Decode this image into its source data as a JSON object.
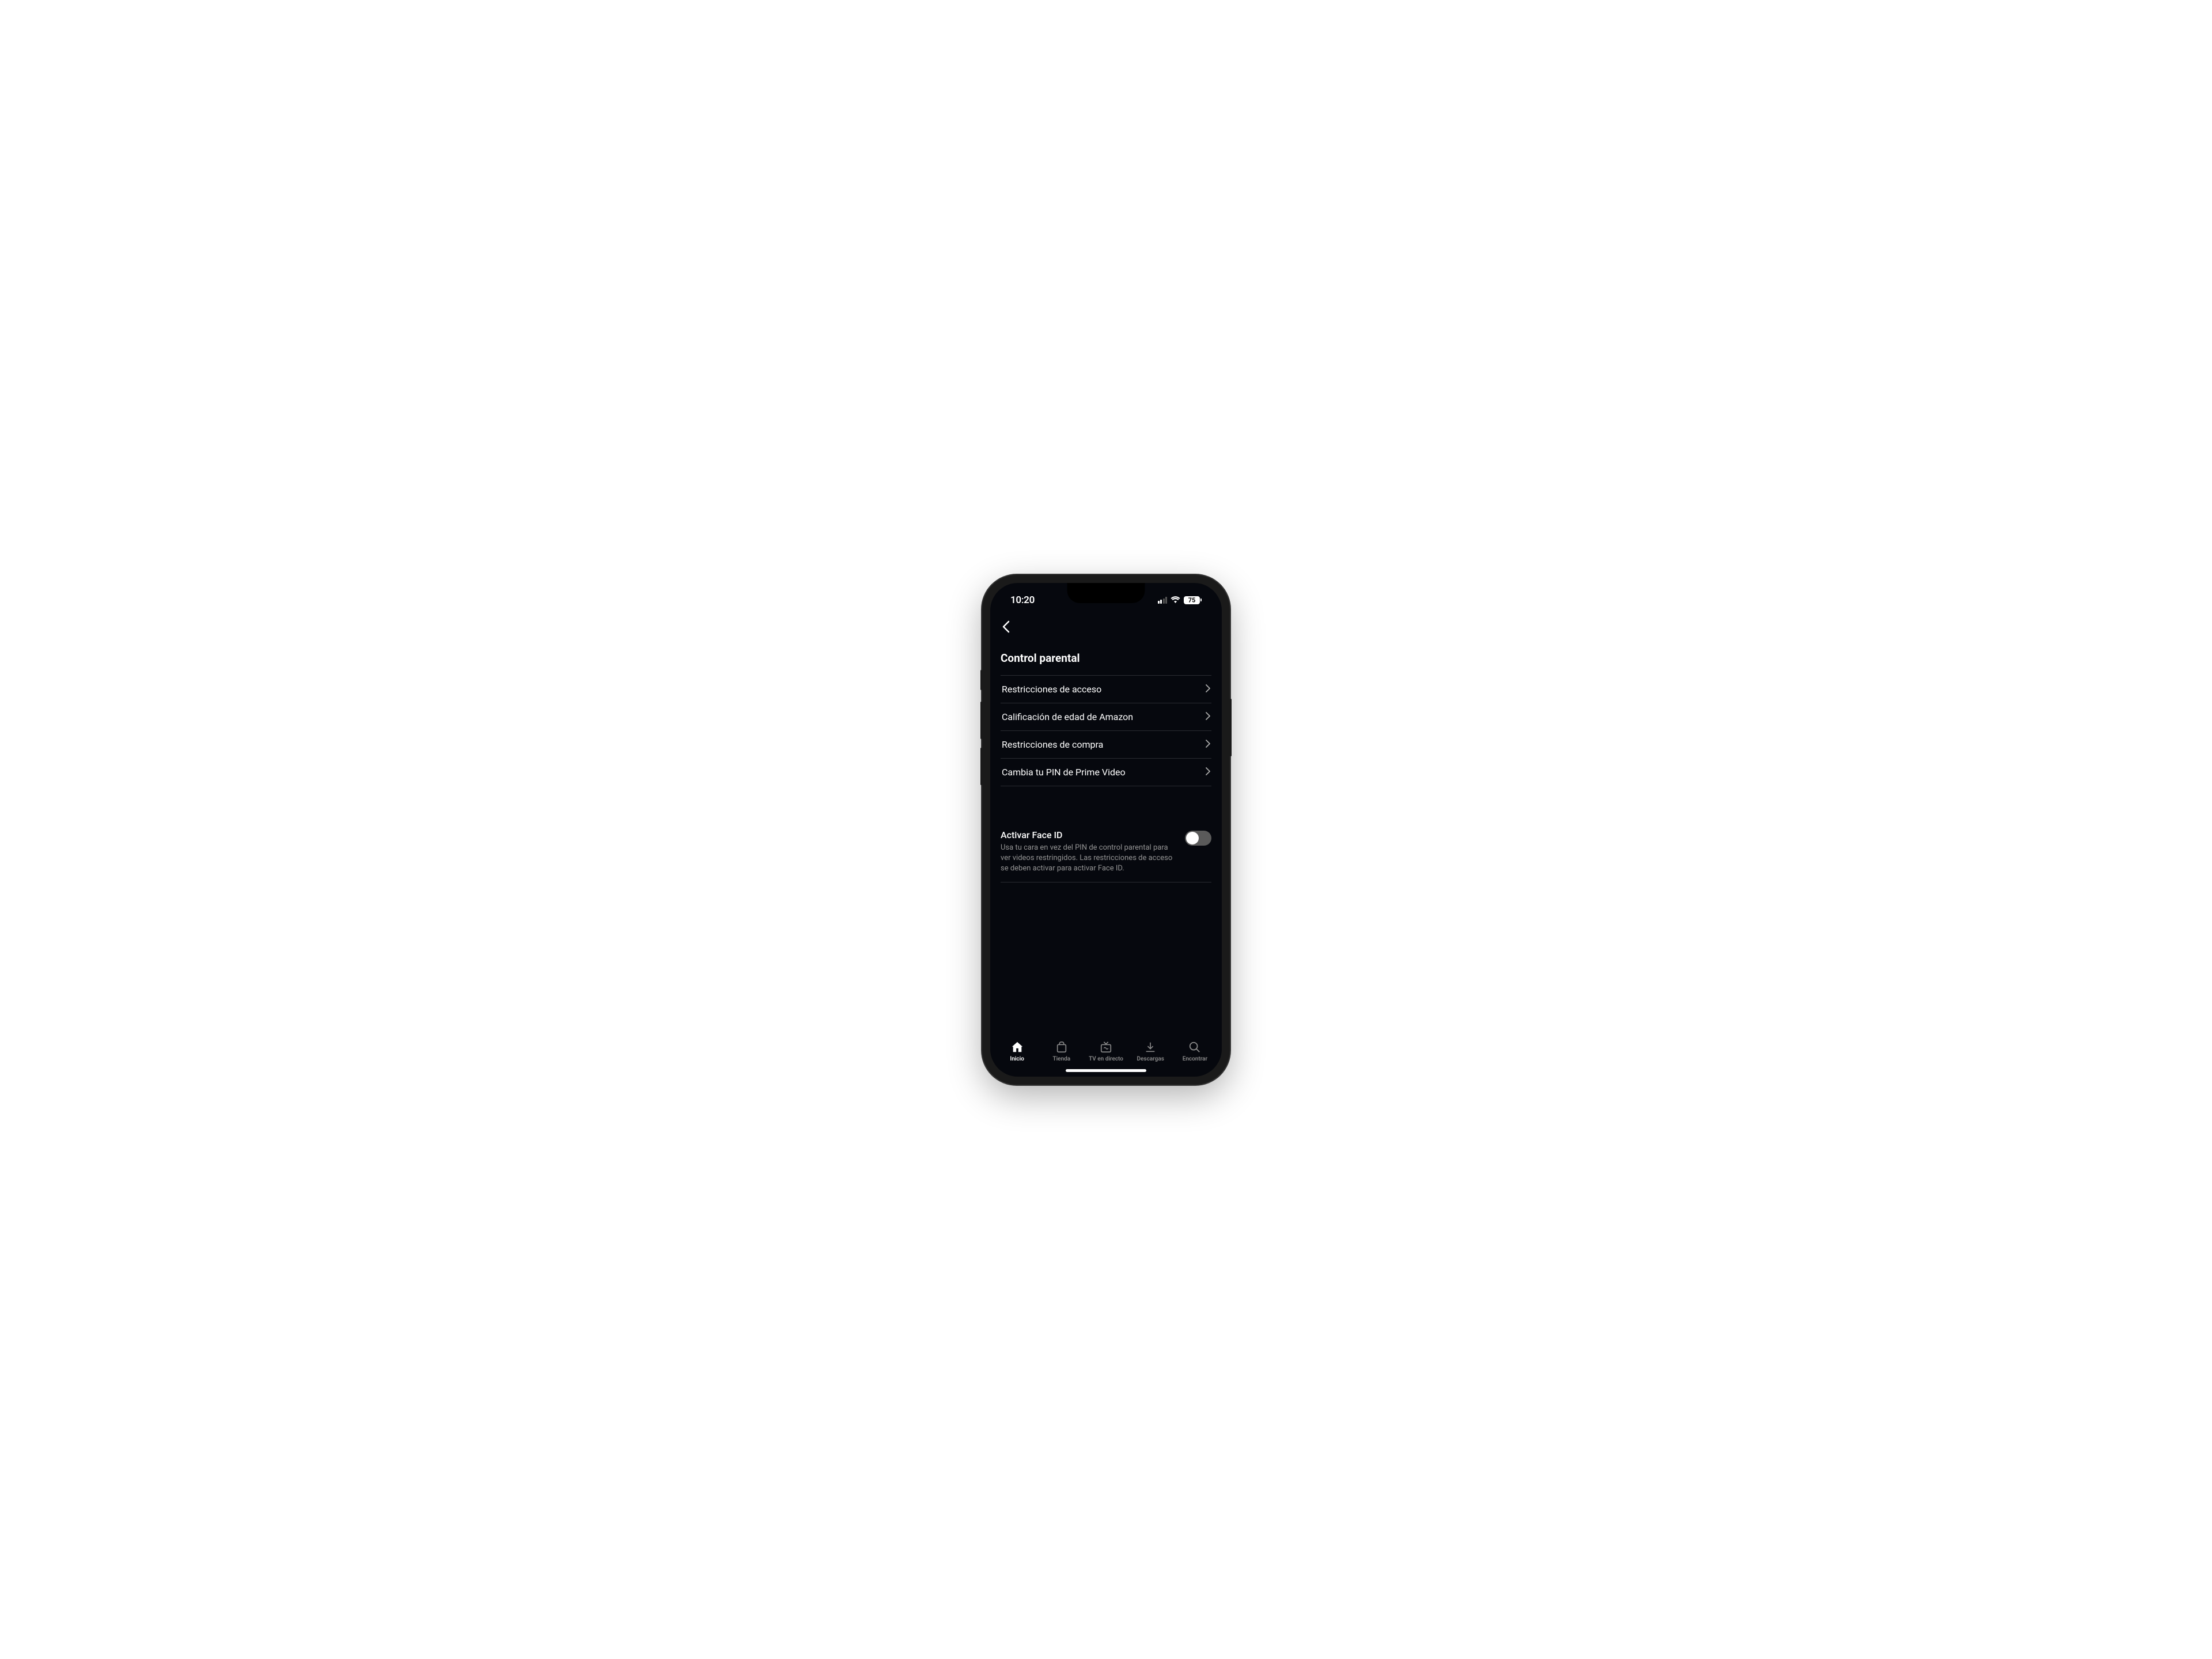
{
  "statusBar": {
    "time": "10:20",
    "battery": "75"
  },
  "page": {
    "title": "Control parental"
  },
  "menu": {
    "items": [
      {
        "label": "Restricciones de acceso"
      },
      {
        "label": "Calificación de edad de Amazon"
      },
      {
        "label": "Restricciones de compra"
      },
      {
        "label": "Cambia tu PIN de Prime Video"
      }
    ]
  },
  "toggle": {
    "title": "Activar Face ID",
    "description": "Usa tu cara en vez del PIN de control parental para ver videos restringidos. Las restricciones de acceso se deben activar para activar Face ID.",
    "enabled": false
  },
  "tabs": {
    "items": [
      {
        "label": "Inicio",
        "active": true
      },
      {
        "label": "Tienda",
        "active": false
      },
      {
        "label": "TV en directo",
        "active": false
      },
      {
        "label": "Descargas",
        "active": false
      },
      {
        "label": "Encontrar",
        "active": false
      }
    ]
  }
}
